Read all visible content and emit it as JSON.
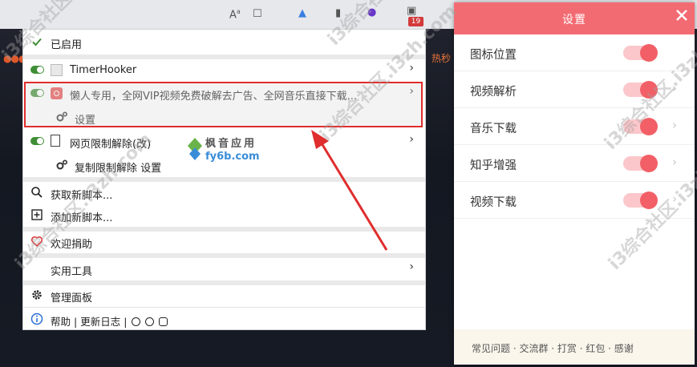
{
  "background": {
    "badge_count": "19",
    "side_text": "热秒",
    "dots": "●●●●"
  },
  "menu": {
    "enabled_label": "已启用",
    "scripts": [
      {
        "name": "TimerHooker"
      },
      {
        "name": "懒人专用，全网VIP视频免费破解去广告、全网音乐直接下载..."
      },
      {
        "name": "网页限制解除(改)"
      }
    ],
    "sub_items": {
      "settings_label": "设置",
      "copy_limit_settings_label": "复制限制解除 设置"
    },
    "get_new_script": "获取新脚本...",
    "add_new_script": "添加新脚本...",
    "donate": "欢迎捐助",
    "utilities": "实用工具",
    "dashboard": "管理面板",
    "footer": {
      "help": "帮助",
      "separator": "|",
      "changelog": "更新日志",
      "separator2": "|"
    }
  },
  "panel": {
    "title": "设置",
    "rows": [
      {
        "label": "图标位置",
        "has_arrow": false
      },
      {
        "label": "视频解析",
        "has_arrow": true
      },
      {
        "label": "音乐下载",
        "has_arrow": true
      },
      {
        "label": "知乎增强",
        "has_arrow": true
      },
      {
        "label": "视频下载",
        "has_arrow": true
      }
    ],
    "footer_links": "常见问题 · 交流群 · 打赏 · 红包 · 感谢",
    "accent_color": "#f36b72"
  },
  "watermark": {
    "logo_line1": "枫音应用",
    "logo_line2": "fy6b.com",
    "repeat_text": "i3综合社区.i3zh.com"
  }
}
